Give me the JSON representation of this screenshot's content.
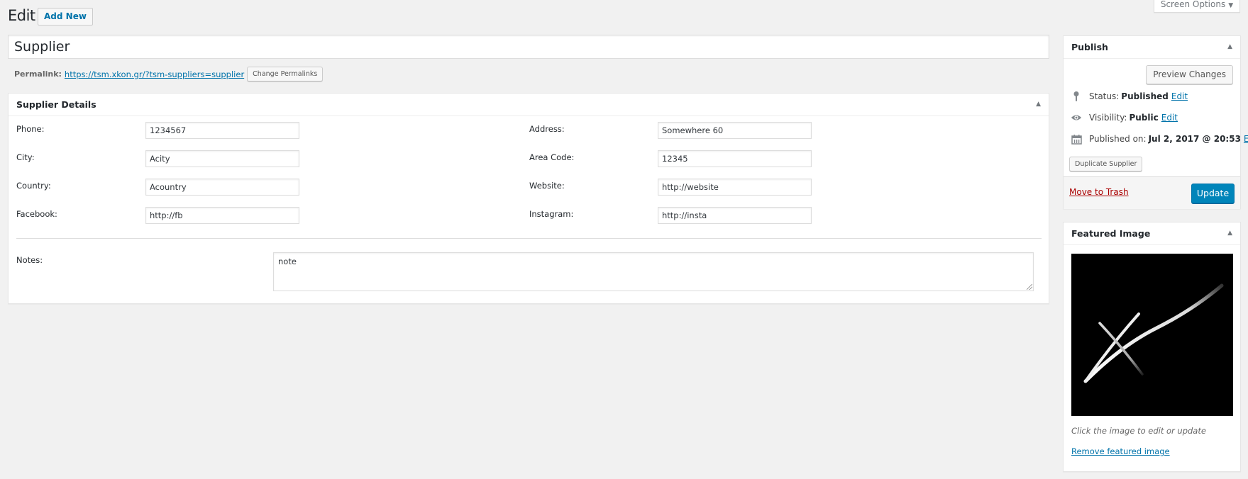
{
  "header": {
    "title": "Edit",
    "add_new_label": "Add New",
    "screen_options_label": "Screen Options",
    "screen_options_arrow": "▼"
  },
  "post": {
    "title_value": "Supplier",
    "permalink_label": "Permalink:",
    "permalink_url": "https://tsm.xkon.gr/?tsm-suppliers=supplier",
    "change_permalinks_label": "Change Permalinks"
  },
  "supplier_details": {
    "heading": "Supplier Details",
    "toggle_icon": "▲",
    "left_fields": [
      {
        "label": "Phone:",
        "value": "1234567"
      },
      {
        "label": "City:",
        "value": "Acity"
      },
      {
        "label": "Country:",
        "value": "Acountry"
      },
      {
        "label": "Facebook:",
        "value": "http://fb"
      }
    ],
    "right_fields": [
      {
        "label": "Address:",
        "value": "Somewhere 60"
      },
      {
        "label": "Area Code:",
        "value": "12345"
      },
      {
        "label": "Website:",
        "value": "http://website"
      },
      {
        "label": "Instagram:",
        "value": "http://insta"
      }
    ],
    "notes_label": "Notes:",
    "notes_value": "note"
  },
  "publish": {
    "heading": "Publish",
    "toggle_icon": "▲",
    "preview_label": "Preview Changes",
    "status_label": "Status:",
    "status_value": "Published",
    "visibility_label": "Visibility:",
    "visibility_value": "Public",
    "published_on_label": "Published on:",
    "published_on_value": "Jul 2, 2017 @ 20:53",
    "edit_label": "Edit",
    "duplicate_label": "Duplicate Supplier",
    "trash_label": "Move to Trash",
    "update_label": "Update",
    "update_color": "#0085ba"
  },
  "featured_image": {
    "heading": "Featured Image",
    "toggle_icon": "▲",
    "caption": "Click the image to edit or update",
    "remove_label": "Remove featured image"
  }
}
